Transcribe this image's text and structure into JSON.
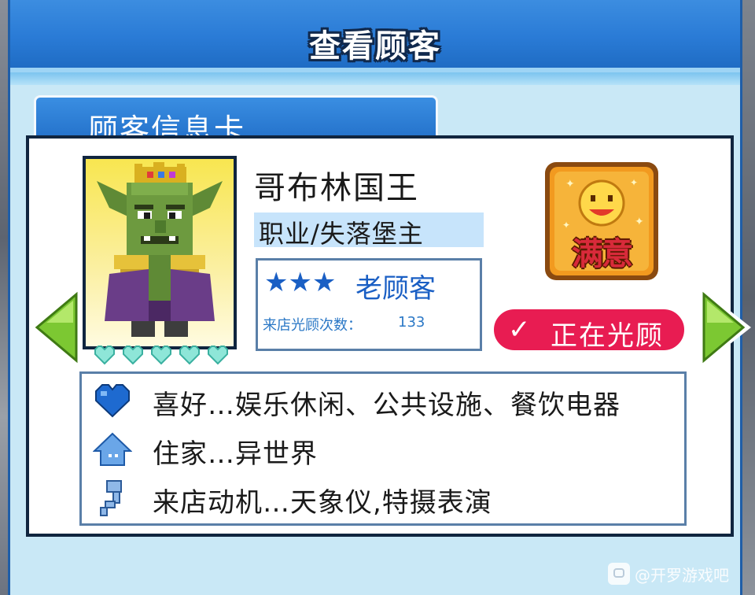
{
  "window": {
    "title": "查看顾客"
  },
  "card_tab": {
    "label": "顾客信息卡"
  },
  "customer": {
    "name": "哥布林国王",
    "job": "职业/失落堡主",
    "rank_stars": "★★★",
    "rank_label": "老顾客",
    "visit_label": "来店光顾次数：",
    "visit_count": "133",
    "hearts_filled": 5,
    "hearts_total": 5
  },
  "satisfaction_badge": {
    "label": "满意",
    "icon": "smiley-face-icon"
  },
  "status": {
    "check": "✓",
    "label": "正在光顾"
  },
  "info": [
    {
      "icon": "heart-icon",
      "text": "喜好…娱乐休闲、公共设施、餐饮电器"
    },
    {
      "icon": "house-icon",
      "text": "住家…异世界"
    },
    {
      "icon": "motivation-icon",
      "text": "来店动机…天象仪,特摄表演"
    }
  ],
  "navigation": {
    "prev_icon": "arrow-left-icon",
    "next_icon": "arrow-right-icon"
  },
  "watermark": {
    "text": "@开罗游戏吧"
  },
  "colors": {
    "title_blue": "#2a7bd6",
    "panel_bg": "#c9e8f6",
    "rank_blue": "#1a5fc4",
    "status_red": "#e81c52",
    "arrow_green": "#7cc832",
    "badge_orange": "#f29a1f"
  }
}
